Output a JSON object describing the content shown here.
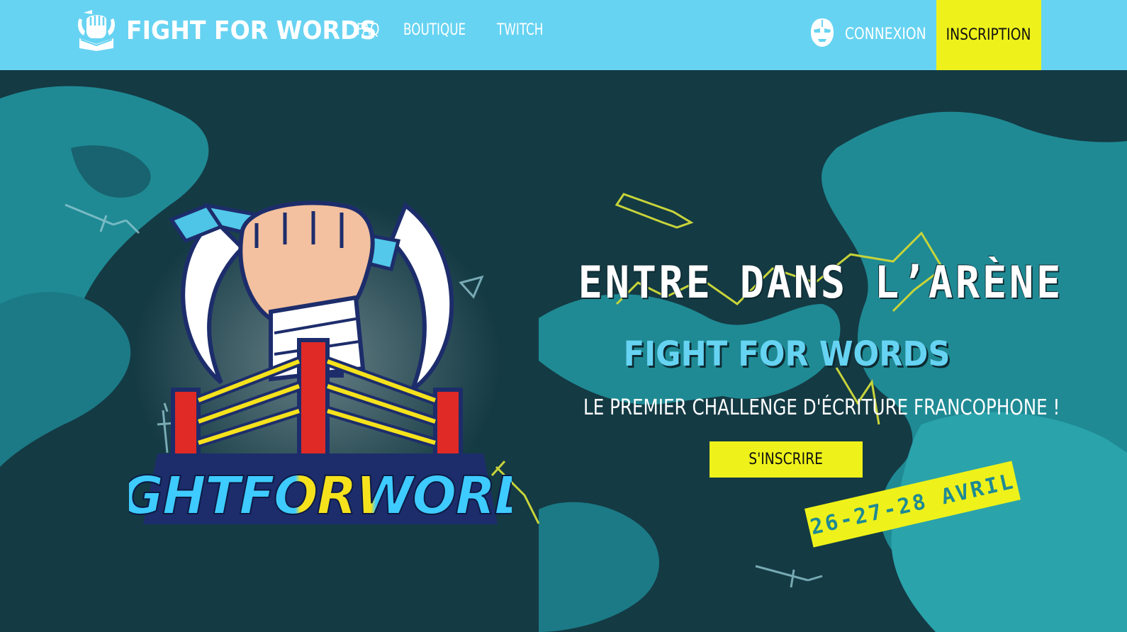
{
  "nav": {
    "brand_name": "FIGHT FOR WORDS",
    "links": [
      {
        "label": "FAQ"
      },
      {
        "label": "BOUTIQUE"
      },
      {
        "label": "TWITCH"
      }
    ],
    "login_label": "CONNEXION",
    "signup_label": "INSCRIPTION"
  },
  "hero": {
    "title": "ENTRE DANS L’ARÈNE",
    "subtitle": "FIGHT FOR WORDS",
    "tagline": "LE PREMIER CHALLENGE D'ÉCRITURE FRANCOPHONE !",
    "cta_label": "S'INSCRIRE",
    "dates": "26-27-28 AVRIL"
  },
  "emblem": {
    "word_fight": "FIGHT",
    "word_for": "FOR",
    "word_words": "WORDS"
  },
  "colors": {
    "nav_bg": "#67d3f2",
    "accent_yellow": "#eef21a",
    "hero_dark": "#143a44",
    "hero_teal": "#1f8a94",
    "title_cyan": "#67d3f2"
  },
  "icons": {
    "brand": "fist-book-icon",
    "login": "wrestler-mask-icon"
  }
}
